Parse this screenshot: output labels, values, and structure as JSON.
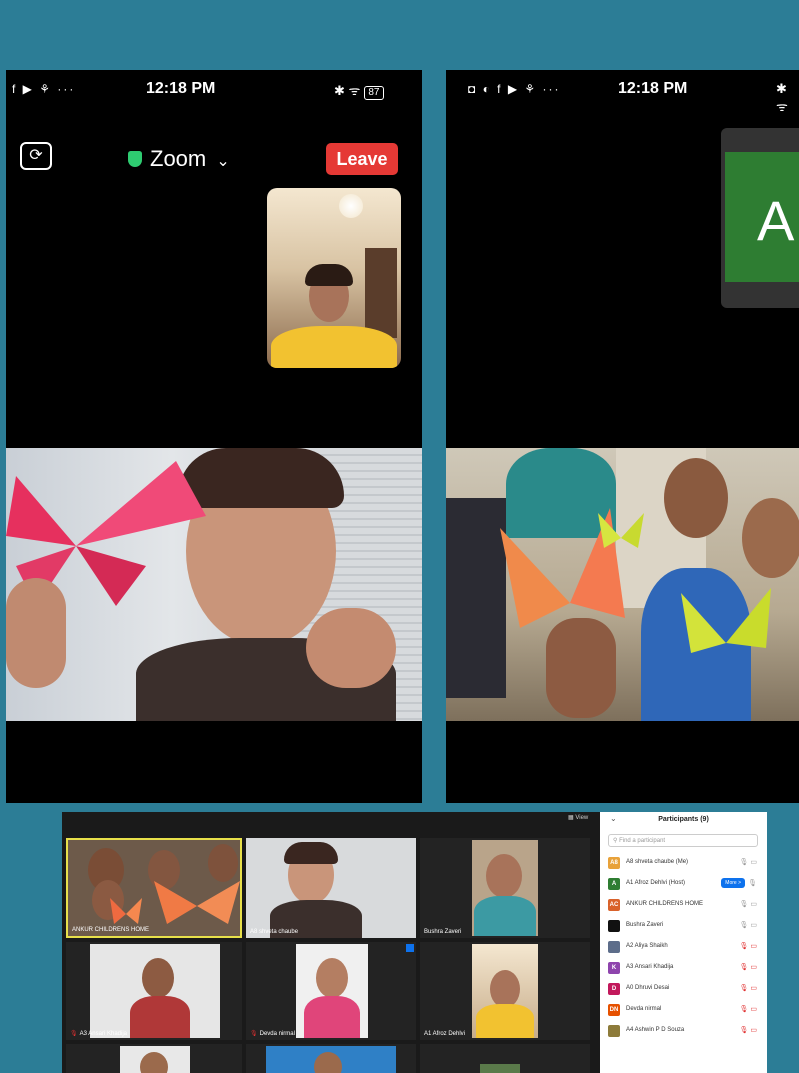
{
  "left_phone": {
    "status_icons": "f ▶ ⚘ ···",
    "time": "12:18 PM",
    "right_icons": "✱ ᯤ",
    "battery": "87",
    "app_title": "Zoom",
    "title_caret": "⌄",
    "leave_label": "Leave",
    "camera_switch_glyph": "⟳"
  },
  "right_phone": {
    "status_icons": "◘ ◐ f ▶ ⚘ ···",
    "time": "12:18 PM",
    "right_icons": "✱ ᯤ",
    "avatar_letter": "A"
  },
  "desktop": {
    "grid_tiles": [
      {
        "name": "ANKUR CHILDRENS HOME",
        "muted": false
      },
      {
        "name": "A8 shveta chaube",
        "muted": false
      },
      {
        "name": "Bushra Zaveri",
        "muted": false
      },
      {
        "name": "A3 Ansari Khadija",
        "muted": true
      },
      {
        "name": "Devda nirmal",
        "muted": true
      },
      {
        "name": "A1 Afroz Dehlvi",
        "muted": false
      }
    ],
    "view_label": "View",
    "participants": {
      "title": "Participants (9)",
      "collapse_glyph": "⌄",
      "search_placeholder": "Find a participant",
      "more_label": "More >",
      "rows": [
        {
          "initials": "A8",
          "name": "A8 shveta chaube (Me)",
          "color": "#e8a23a",
          "muted": false
        },
        {
          "initials": "A",
          "name": "A1 Afroz Dehlvi (Host)",
          "color": "#2e7d32",
          "muted": false
        },
        {
          "initials": "AC",
          "name": "ANKUR CHILDRENS HOME",
          "color": "#d9622b",
          "muted": false
        },
        {
          "initials": "",
          "name": "Bushra Zaveri",
          "color": "#111111",
          "muted": false
        },
        {
          "initials": "",
          "name": "A2 Aliya Shaikh",
          "color": "#5d6d8a",
          "muted": true
        },
        {
          "initials": "K",
          "name": "A3 Ansari Khadija",
          "color": "#8e44ad",
          "muted": true
        },
        {
          "initials": "D",
          "name": "A0 Dhruvi Desai",
          "color": "#c2185b",
          "muted": true
        },
        {
          "initials": "DN",
          "name": "Devda nirmal",
          "color": "#e65100",
          "muted": true
        },
        {
          "initials": "",
          "name": "A4 Ashwin P D Souza",
          "color": "#8d7b3a",
          "muted": true
        }
      ]
    }
  },
  "colors": {
    "background": "#2c7d96",
    "leave_button": "#e53935",
    "shield": "#2ecc71",
    "green_tile": "#2e7d32",
    "active_speaker_border": "#e8e04a",
    "more_button": "#0e72ed"
  },
  "icons": {
    "camera_switch": "camera-switch-icon",
    "shield": "shield-check-icon",
    "mic": "microphone-icon",
    "video": "video-camera-icon"
  }
}
